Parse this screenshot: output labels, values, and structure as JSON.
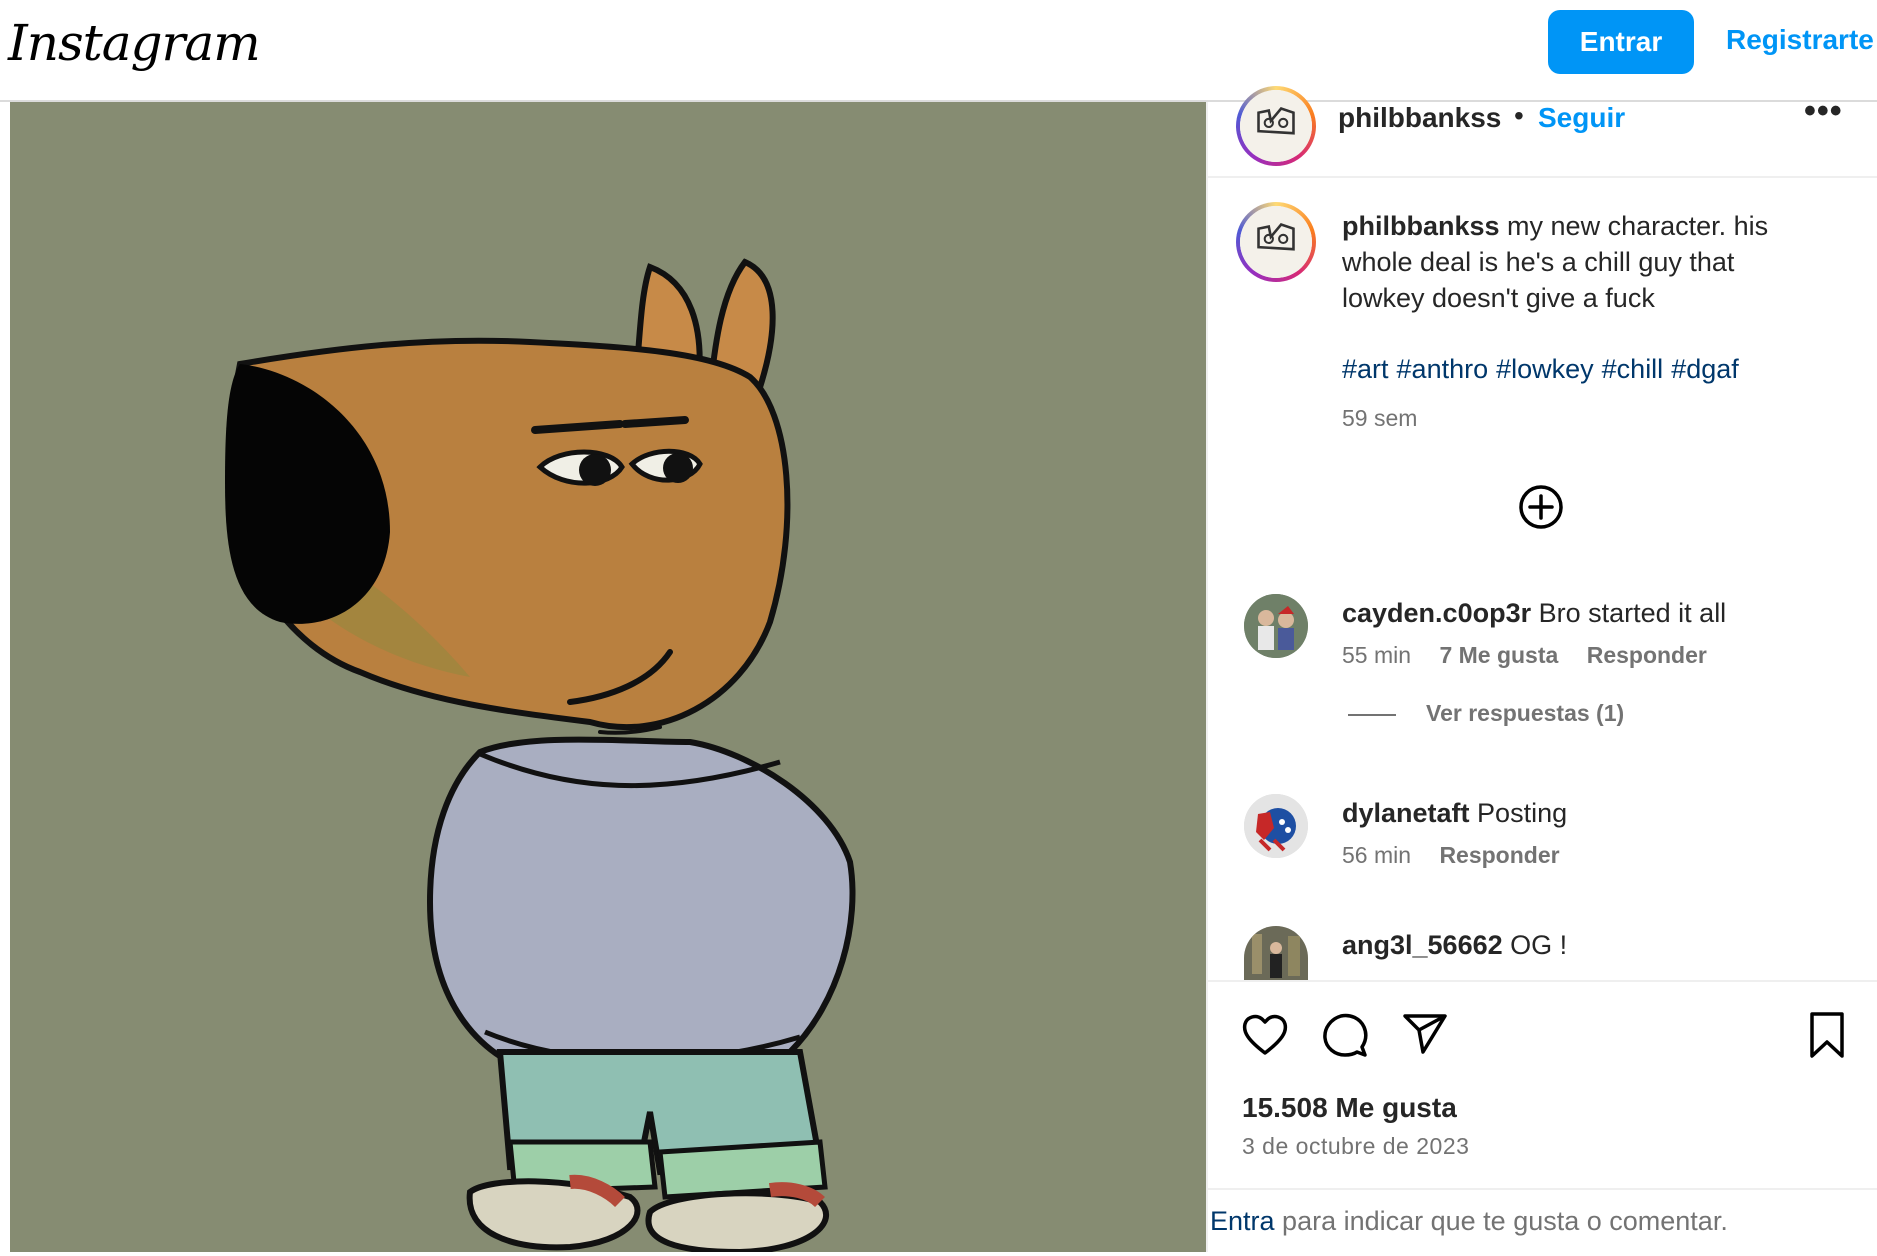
{
  "topbar": {
    "logo": "Instagram",
    "login": "Entrar",
    "signup": "Registrarte"
  },
  "post": {
    "username": "philbbankss",
    "separator": "•",
    "follow": "Seguir",
    "more": "•••",
    "caption_user": "philbbankss",
    "caption_text": "my new character. his whole deal is he's a chill guy that lowkey doesn't give a fuck",
    "hashtags": [
      "#art",
      "#anthro",
      "#lowkey",
      "#chill",
      "#dgaf"
    ],
    "caption_time": "59 sem",
    "likes": "15.508 Me gusta",
    "date": "3 de octubre de 2023"
  },
  "comments": [
    {
      "user": "cayden.c0op3r",
      "text": "Bro started it all",
      "time": "55 min",
      "likes": "7 Me gusta",
      "reply": "Responder",
      "view_replies": "Ver respuestas (1)"
    },
    {
      "user": "dylanetaft",
      "text": "Posting",
      "time": "56 min",
      "reply": "Responder"
    },
    {
      "user": "ang3l_56662",
      "text": "OG !"
    }
  ],
  "footer": {
    "link": "Entra",
    "text": " para indicar que te gusta o comentar."
  },
  "colors": {
    "accent": "#0095f6",
    "hashtag": "#00376b",
    "media_bg": "#868c72",
    "muted": "#737373"
  },
  "icons": [
    "heart-icon",
    "comment-icon",
    "share-icon",
    "bookmark-icon",
    "add-circle-icon",
    "more-icon"
  ]
}
